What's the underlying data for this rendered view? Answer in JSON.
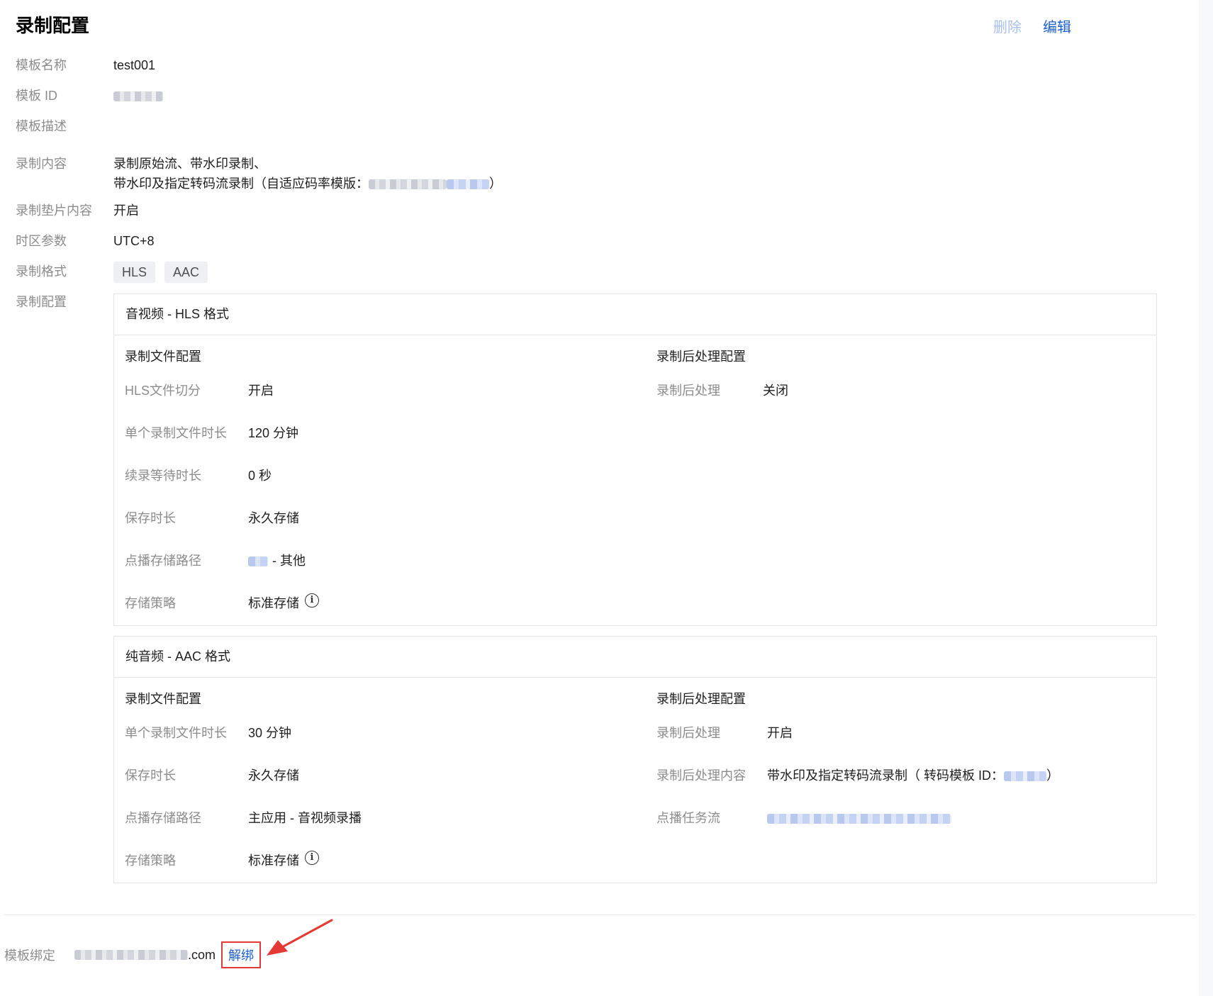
{
  "header": {
    "title": "录制配置",
    "delete_label": "删除",
    "edit_label": "编辑"
  },
  "info": {
    "name_label": "模板名称",
    "name_value": "test001",
    "id_label": "模板 ID",
    "desc_label": "模板描述",
    "desc_value": "",
    "content_label": "录制内容",
    "content_line1": "录制原始流、带水印录制、",
    "content_line2_prefix": "带水印及指定转码流录制（自适应码率模版：",
    "content_line2_suffix": "）",
    "slate_label": "录制垫片内容",
    "slate_value": "开启",
    "tz_label": "时区参数",
    "tz_value": "UTC+8",
    "format_label": "录制格式",
    "formats": [
      "HLS",
      "AAC"
    ],
    "config_label": "录制配置"
  },
  "hls": {
    "header": "音视频 - HLS 格式",
    "file_title": "录制文件配置",
    "post_title": "录制后处理配置",
    "slice_label": "HLS文件切分",
    "slice_value": "开启",
    "duration_label": "单个录制文件时长",
    "duration_value": "120 分钟",
    "wait_label": "续录等待时长",
    "wait_value": "0 秒",
    "keep_label": "保存时长",
    "keep_value": "永久存储",
    "path_label": "点播存储路径",
    "path_value": "- 其他",
    "policy_label": "存储策略",
    "policy_value": "标准存储",
    "post_label": "录制后处理",
    "post_value": "关闭"
  },
  "aac": {
    "header": "纯音频 - AAC 格式",
    "file_title": "录制文件配置",
    "post_title": "录制后处理配置",
    "duration_label": "单个录制文件时长",
    "duration_value": "30 分钟",
    "keep_label": "保存时长",
    "keep_value": "永久存储",
    "path_label": "点播存储路径",
    "path_value": "主应用 - 音视频录播",
    "policy_label": "存储策略",
    "policy_value": "标准存储",
    "post_label": "录制后处理",
    "post_value": "开启",
    "post_content_label": "录制后处理内容",
    "post_content_prefix": "带水印及指定转码流录制（ 转码模板 ID：",
    "post_content_suffix": "）",
    "task_label": "点播任务流"
  },
  "binding": {
    "label": "模板绑定",
    "domain_suffix": ".com",
    "unbind_label": "解绑"
  },
  "colors": {
    "link": "#1c5fd1",
    "highlight_border": "#e53935",
    "arrow": "#e53935",
    "disabled": "#a8c1ec"
  }
}
